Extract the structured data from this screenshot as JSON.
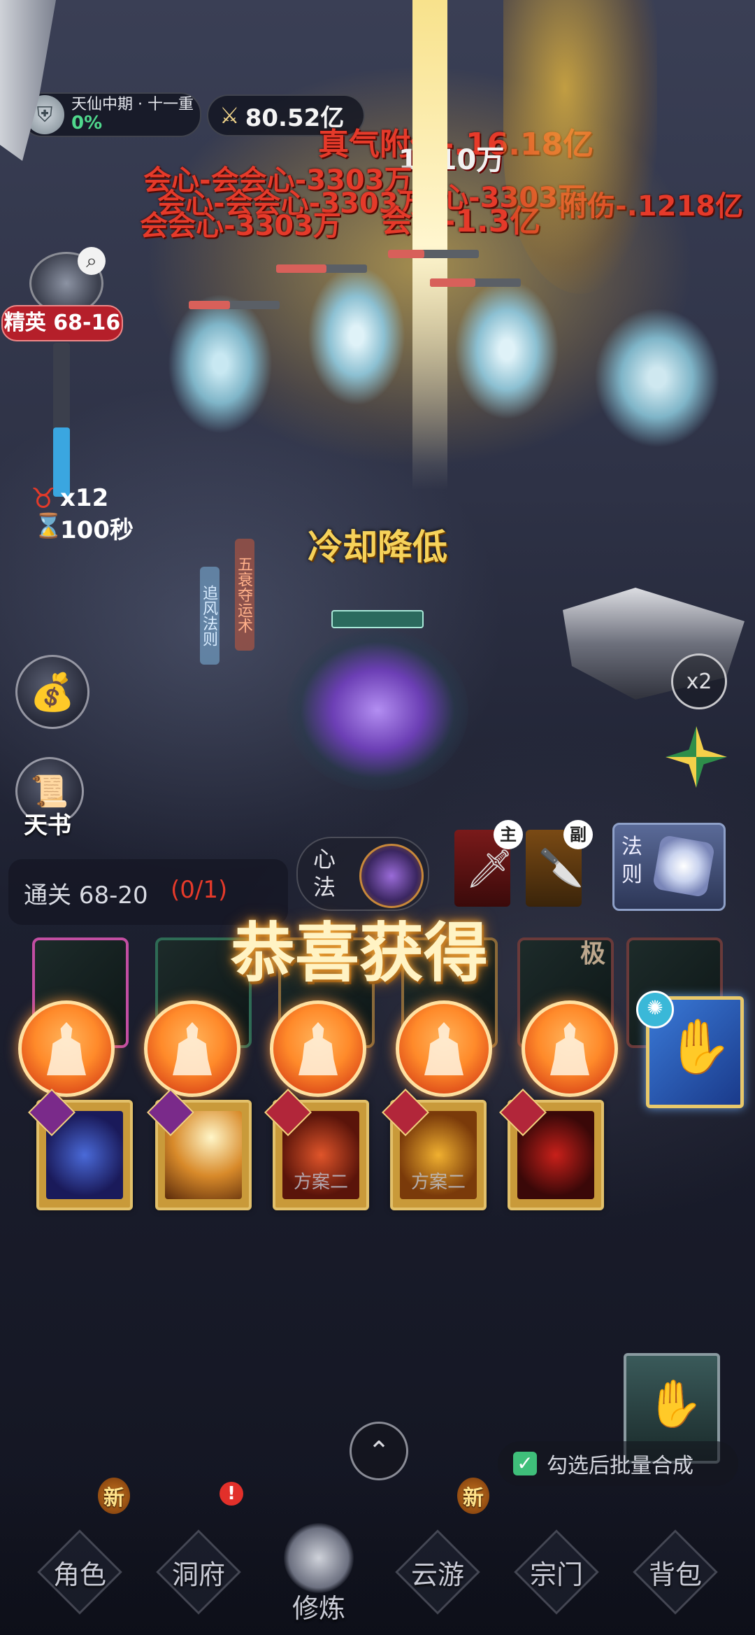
{
  "player": {
    "realm": "天仙中期 · 十一重",
    "progress": "0%",
    "power": "80.52亿"
  },
  "stage": {
    "label": "精英 68-16",
    "enemy_count": "x12",
    "timer": "100秒",
    "clear_label": "通关 68-20",
    "clear_progress": "(0/1)"
  },
  "damage_texts": [
    "真气附伤-.16.18亿",
    "1610万",
    "会心-会会心-3303万",
    "会心-会会心-3303万",
    "会会心-3303万",
    "会心-1.3亿",
    "会心-3303万",
    "附伤-.1218亿"
  ],
  "skill_popup": "冷却降低",
  "battle_tags": {
    "left": "追风法则",
    "right": "五衰夺运术"
  },
  "side_buttons": {
    "bag_icon": "money-bag-icon",
    "book_label": "天书",
    "speed_label": "x2"
  },
  "equipment": {
    "xinfa_label": "心法",
    "main_label": "主",
    "sub_label": "副",
    "law_label": "法则"
  },
  "reward": {
    "title": "恭喜获得",
    "coins": 5,
    "extreme_label": "极"
  },
  "scrolls": {
    "plan_labels": [
      "方案二",
      "方案二"
    ]
  },
  "batch": {
    "label": "勾选后批量合成",
    "checked": true
  },
  "nav": {
    "items": [
      {
        "label": "角色",
        "badge": "新"
      },
      {
        "label": "洞府",
        "badge": "!"
      },
      {
        "label": "修炼",
        "badge": ""
      },
      {
        "label": "云游",
        "badge": "新"
      },
      {
        "label": "宗门",
        "badge": ""
      },
      {
        "label": "背包",
        "badge": ""
      }
    ]
  },
  "colors": {
    "damage": "#e53a2a",
    "gold": "#f6d25a",
    "teal_progress": "#3aa6e0",
    "elite_red": "#b51f2a"
  }
}
